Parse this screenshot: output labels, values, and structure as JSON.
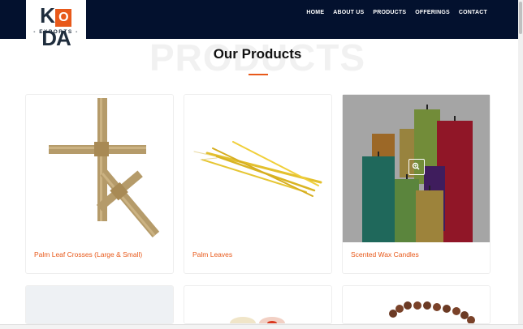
{
  "brand": {
    "logo_left": "K",
    "logo_o": "O",
    "logo_right": "DA",
    "logo_sub": "- EXPORTS -"
  },
  "nav": {
    "items": [
      "HOME",
      "ABOUT US",
      "PRODUCTS",
      "OFFERINGS",
      "CONTACT"
    ]
  },
  "section": {
    "background_title": "PRODUCTS",
    "title": "Our Products"
  },
  "products": [
    {
      "name": "Palm Leaf Crosses (Large & Small)"
    },
    {
      "name": "Palm Leaves"
    },
    {
      "name": "Scented Wax Candles"
    }
  ],
  "colors": {
    "header_bg": "#03112e",
    "accent": "#e8591a",
    "nav_text": "#ffffff"
  },
  "icons": {
    "zoom": "zoom-icon"
  }
}
